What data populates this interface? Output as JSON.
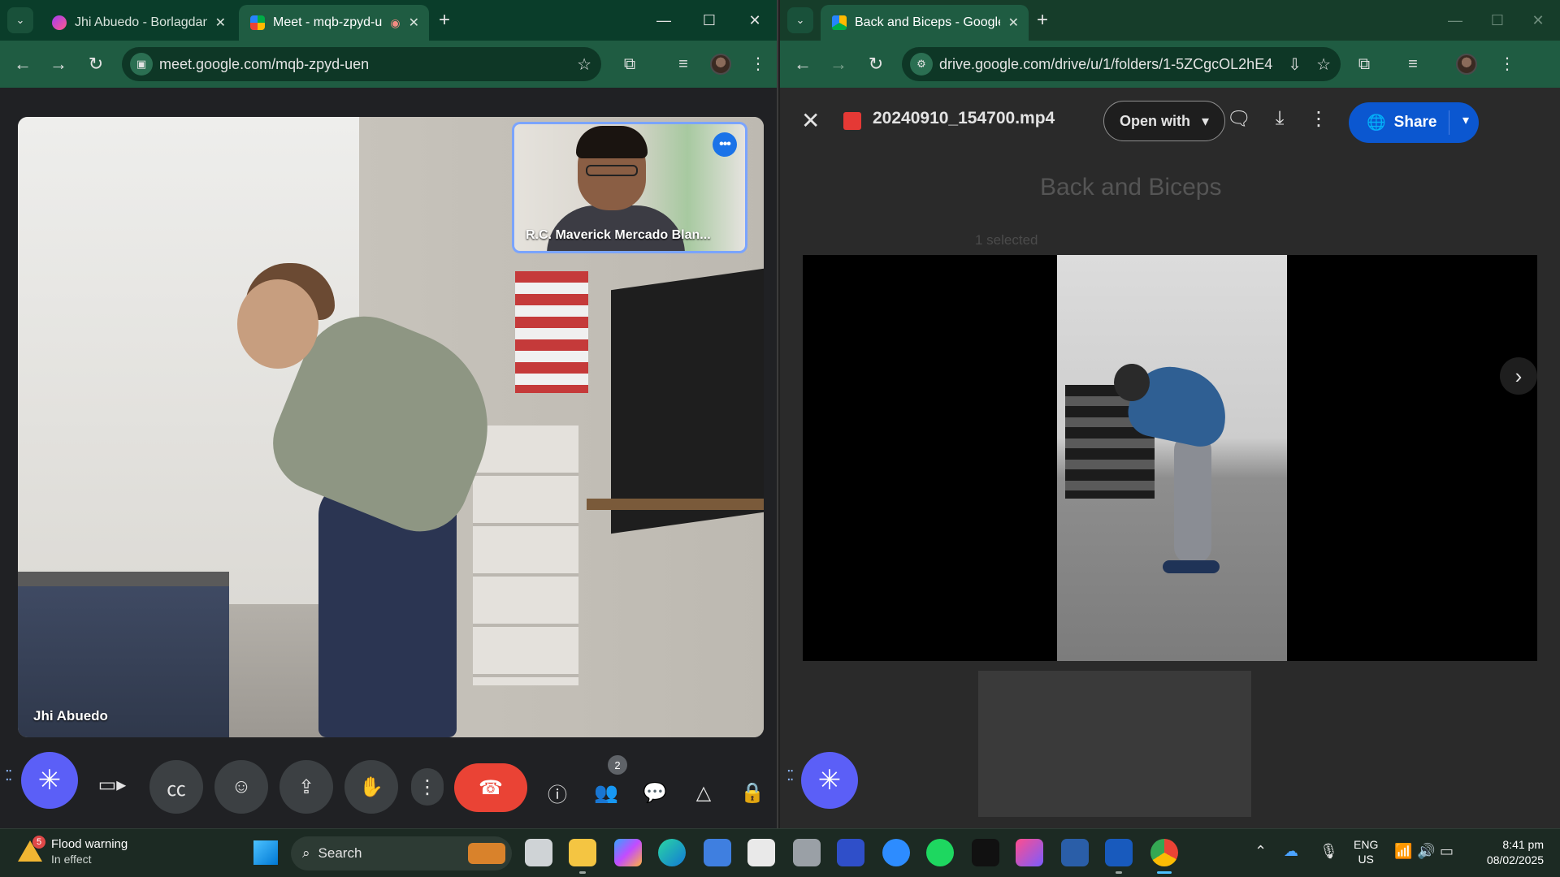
{
  "left_window": {
    "tabs": [
      {
        "title": "Jhi Abuedo - Borlagdan | Messe",
        "active": false
      },
      {
        "title": "Meet - mqb-zpyd-uen",
        "active": true
      }
    ],
    "url": "meet.google.com/mqb-zpyd-uen",
    "meet": {
      "main_participant": "Jhi Abuedo",
      "pip_participant": "R.C. Maverick Mercado Blan...",
      "people_count": "2"
    }
  },
  "right_window": {
    "tabs": [
      {
        "title": "Back and Biceps - Google Drive",
        "active": true
      }
    ],
    "url": "drive.google.com/drive/u/1/folders/1-5ZCgcOL2hE4P7_...",
    "viewer": {
      "file_name": "20240910_154700.mp4",
      "open_with_label": "Open with",
      "share_label": "Share",
      "folder_title": "Back and Biceps",
      "selected_text": "1 selected"
    }
  },
  "taskbar": {
    "weather_title": "Flood warning",
    "weather_subtitle": "In effect",
    "weather_badge": "5",
    "search_placeholder": "Search",
    "lang_line1": "ENG",
    "lang_line2": "US",
    "time": "8:41 pm",
    "date": "08/02/2025"
  },
  "colors": {
    "tab_strip": "#0a3d2a",
    "toolbar": "#1f5c42",
    "end_call": "#ea4335",
    "share_button": "#0b57d0",
    "gemini_button": "#5b5ff7"
  }
}
